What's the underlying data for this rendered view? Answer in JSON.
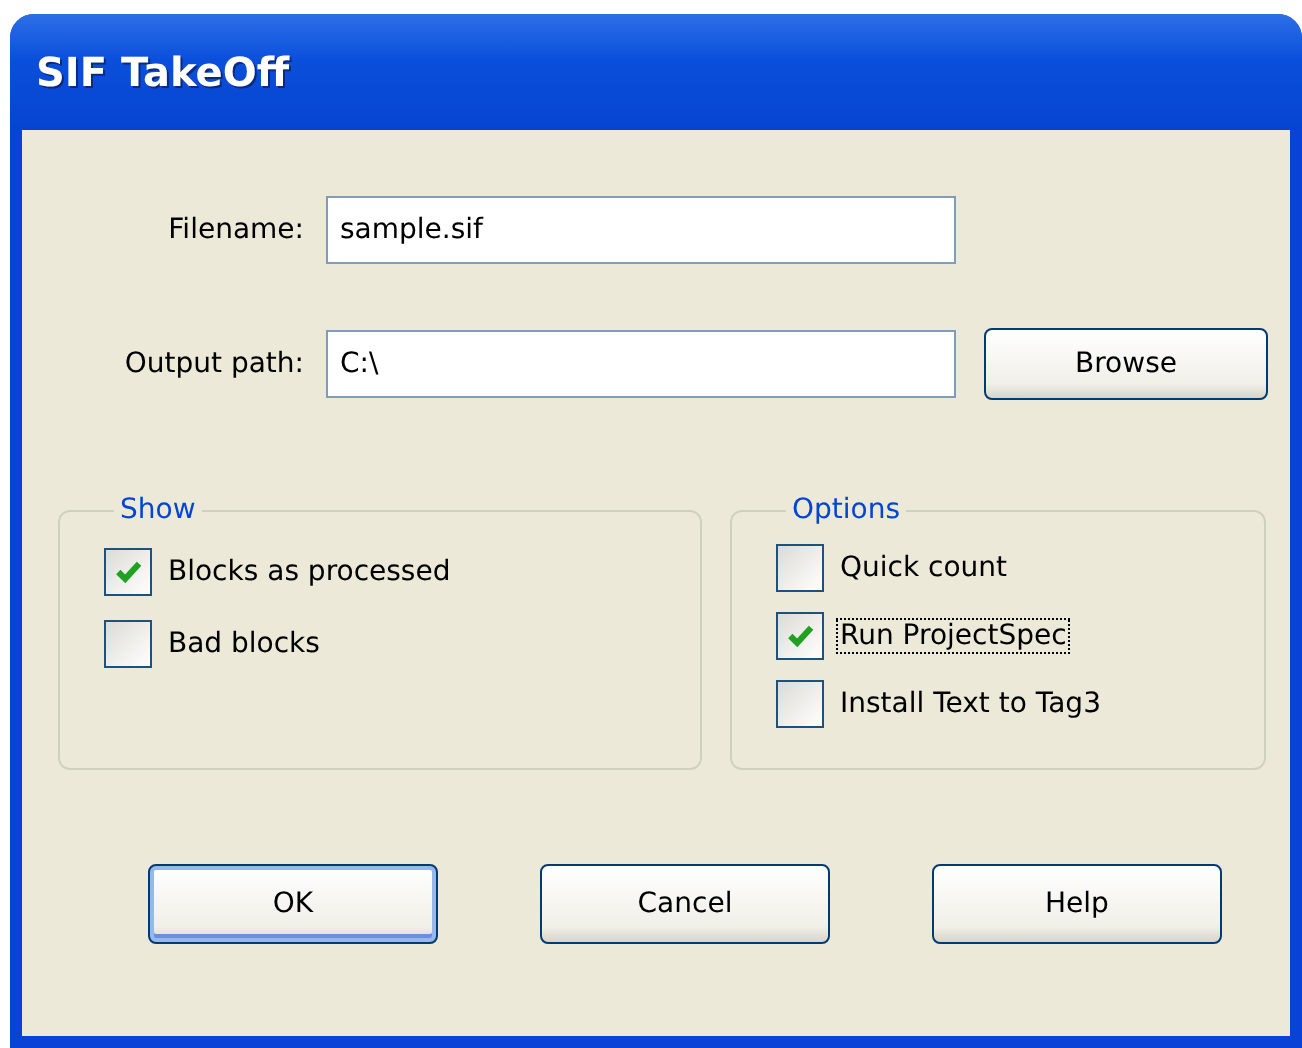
{
  "window": {
    "title": "SIF TakeOff"
  },
  "fields": [
    {
      "label": "Filename:",
      "value": "sample.sif"
    },
    {
      "label": "Output path:",
      "value": "C:\\",
      "button": "Browse"
    }
  ],
  "groups": [
    {
      "title": "Show",
      "options": [
        {
          "label": "Blocks as processed",
          "checked": true,
          "focused": false
        },
        {
          "label": "Bad blocks",
          "checked": false,
          "focused": false
        }
      ]
    },
    {
      "title": "Options",
      "options": [
        {
          "label": "Quick count",
          "checked": false,
          "focused": false
        },
        {
          "label": "Run ProjectSpec",
          "checked": true,
          "focused": true
        },
        {
          "label": "Install Text to Tag3",
          "checked": false,
          "focused": false
        }
      ]
    }
  ],
  "buttons": [
    {
      "label": "OK",
      "default": true
    },
    {
      "label": "Cancel",
      "default": false
    },
    {
      "label": "Help",
      "default": false
    }
  ]
}
